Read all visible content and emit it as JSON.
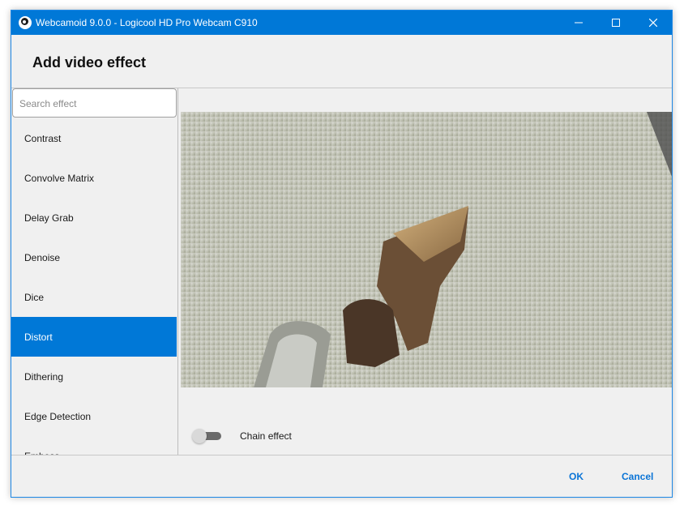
{
  "window": {
    "title": "Webcamoid 9.0.0 - Logicool HD Pro Webcam C910",
    "accent_color": "#0078d7",
    "icons": {
      "app": "webcam-app-icon",
      "minimize": "minimize-icon",
      "maximize": "maximize-icon",
      "close": "close-icon"
    }
  },
  "header": {
    "title": "Add video effect"
  },
  "search": {
    "placeholder": "Search effect",
    "value": ""
  },
  "effects": {
    "selected": "Distort",
    "items": [
      {
        "label": "Contrast"
      },
      {
        "label": "Convolve Matrix"
      },
      {
        "label": "Delay Grab"
      },
      {
        "label": "Denoise"
      },
      {
        "label": "Dice"
      },
      {
        "label": "Distort"
      },
      {
        "label": "Dithering"
      },
      {
        "label": "Edge Detection"
      },
      {
        "label": "Emboss"
      }
    ]
  },
  "preview": {
    "chain_label": "Chain effect",
    "chain_enabled": false
  },
  "footer": {
    "ok_label": "OK",
    "cancel_label": "Cancel"
  }
}
